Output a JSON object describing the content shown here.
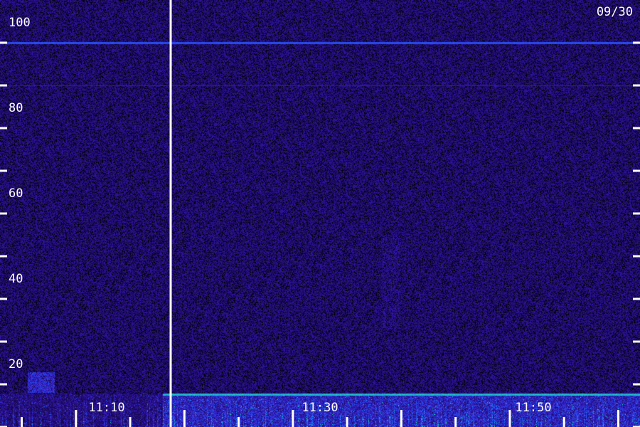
{
  "chart_data": {
    "type": "heatmap",
    "date_label": "09/30",
    "y_axis": {
      "ticks": [
        20,
        40,
        60,
        80,
        100
      ],
      "tick_labels": [
        "20",
        "40",
        "60",
        "80",
        "100"
      ],
      "minor_ticks": [
        10,
        30,
        50,
        70,
        90
      ],
      "range": [
        10,
        110
      ]
    },
    "x_axis": {
      "time_labels": [
        "11:10",
        "11:30",
        "11:50"
      ],
      "time_values": [
        10,
        30,
        50
      ],
      "range": [
        3,
        62
      ],
      "data_gap_at": 18
    },
    "colormap": [
      "#000000",
      "#1a0a5a",
      "#3a1ac8",
      "#2060ff",
      "#20d0c0",
      "#40ff60"
    ],
    "features": [
      {
        "name": "horizontal line",
        "y": 100
      },
      {
        "name": "faint horizontal line",
        "y": 90
      },
      {
        "name": "low-frequency noise band",
        "y_range": [
          10,
          18
        ]
      },
      {
        "name": "bright patch",
        "x_range": [
          5.5,
          8
        ],
        "y_range": [
          18,
          23
        ]
      },
      {
        "name": "faint vertical streak",
        "x": 39,
        "y_range": [
          33,
          55
        ]
      }
    ]
  }
}
